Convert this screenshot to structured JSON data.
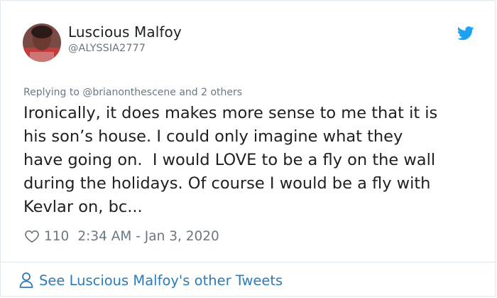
{
  "user": {
    "display_name": "Luscious Malfoy",
    "handle": "@ALYSSIA2777"
  },
  "tweet": {
    "reply_context": "Replying to @brianonthescene and 2 others",
    "text": "Ironically, it does makes more sense to me that it is\nhis son’s house. I could only imagine what they\nhave going on.  I would LOVE to be a fly on the wall\nduring the holidays. Of course I would be a fly with\nKevlar on, bc...",
    "like_count": "110",
    "timestamp": "2:34 AM - Jan 3, 2020"
  },
  "footer": {
    "link_label": "See Luscious Malfoy's other Tweets"
  },
  "icons": {
    "brand": "twitter-bird-icon",
    "like": "heart-icon",
    "profile": "person-icon"
  },
  "colors": {
    "brand": "#1da1f2",
    "link": "#2b7bb9",
    "secondary_text": "#697882",
    "primary_text": "#1c2022",
    "border": "#e1e8ed"
  }
}
